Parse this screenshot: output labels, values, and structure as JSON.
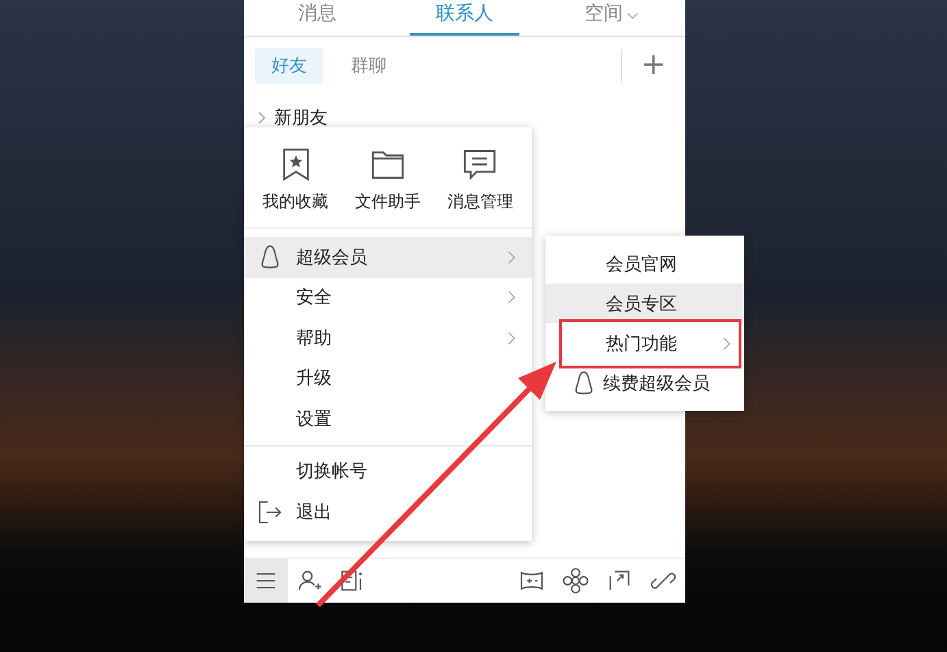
{
  "tabs": [
    {
      "label": "消息",
      "selected": false,
      "dropdown": false
    },
    {
      "label": "联系人",
      "selected": true,
      "dropdown": false
    },
    {
      "label": "空间",
      "selected": false,
      "dropdown": true
    }
  ],
  "subtabs": [
    {
      "label": "好友",
      "selected": true
    },
    {
      "label": "群聊",
      "selected": false
    }
  ],
  "add_button": "+",
  "groups": [
    {
      "label": "新朋友",
      "expanded": false
    }
  ],
  "menu": {
    "shortcuts": [
      {
        "label": "我的收藏",
        "kind": "bookmark"
      },
      {
        "label": "文件助手",
        "kind": "folder"
      },
      {
        "label": "消息管理",
        "kind": "message"
      }
    ],
    "items": [
      {
        "label": "超级会员",
        "kind": "penguin",
        "has_submenu": true,
        "selected": true,
        "divider_before": false
      },
      {
        "label": "安全",
        "kind": "plain",
        "has_submenu": true,
        "selected": false,
        "divider_before": false
      },
      {
        "label": "帮助",
        "kind": "plain",
        "has_submenu": true,
        "selected": false,
        "divider_before": false
      },
      {
        "label": "升级",
        "kind": "plain",
        "has_submenu": false,
        "selected": false,
        "divider_before": false
      },
      {
        "label": "设置",
        "kind": "plain",
        "has_submenu": false,
        "selected": false,
        "divider_before": false
      },
      {
        "label": "切换帐号",
        "kind": "plain",
        "has_submenu": false,
        "selected": false,
        "divider_before": true
      },
      {
        "label": "退出",
        "kind": "exit",
        "has_submenu": false,
        "selected": false,
        "divider_before": false
      }
    ]
  },
  "submenu": {
    "items": [
      {
        "label": "会员官网",
        "kind": "plain",
        "has_submenu": false,
        "selected": false,
        "highlighted": false
      },
      {
        "label": "会员专区",
        "kind": "plain",
        "has_submenu": false,
        "selected": true,
        "highlighted": false
      },
      {
        "label": "热门功能",
        "kind": "plain",
        "has_submenu": true,
        "selected": false,
        "highlighted": true
      },
      {
        "label": "续费超级会员",
        "kind": "penguin",
        "has_submenu": false,
        "selected": false,
        "highlighted": false
      }
    ]
  },
  "bottom_bar": {
    "left": [
      {
        "kind": "menu",
        "selected": true
      },
      {
        "kind": "add-contact",
        "selected": false
      },
      {
        "kind": "contact-card",
        "selected": false
      }
    ],
    "right": [
      {
        "kind": "game",
        "selected": false
      },
      {
        "kind": "flower",
        "selected": false
      },
      {
        "kind": "screen-share",
        "selected": false
      },
      {
        "kind": "link",
        "selected": false
      }
    ]
  }
}
